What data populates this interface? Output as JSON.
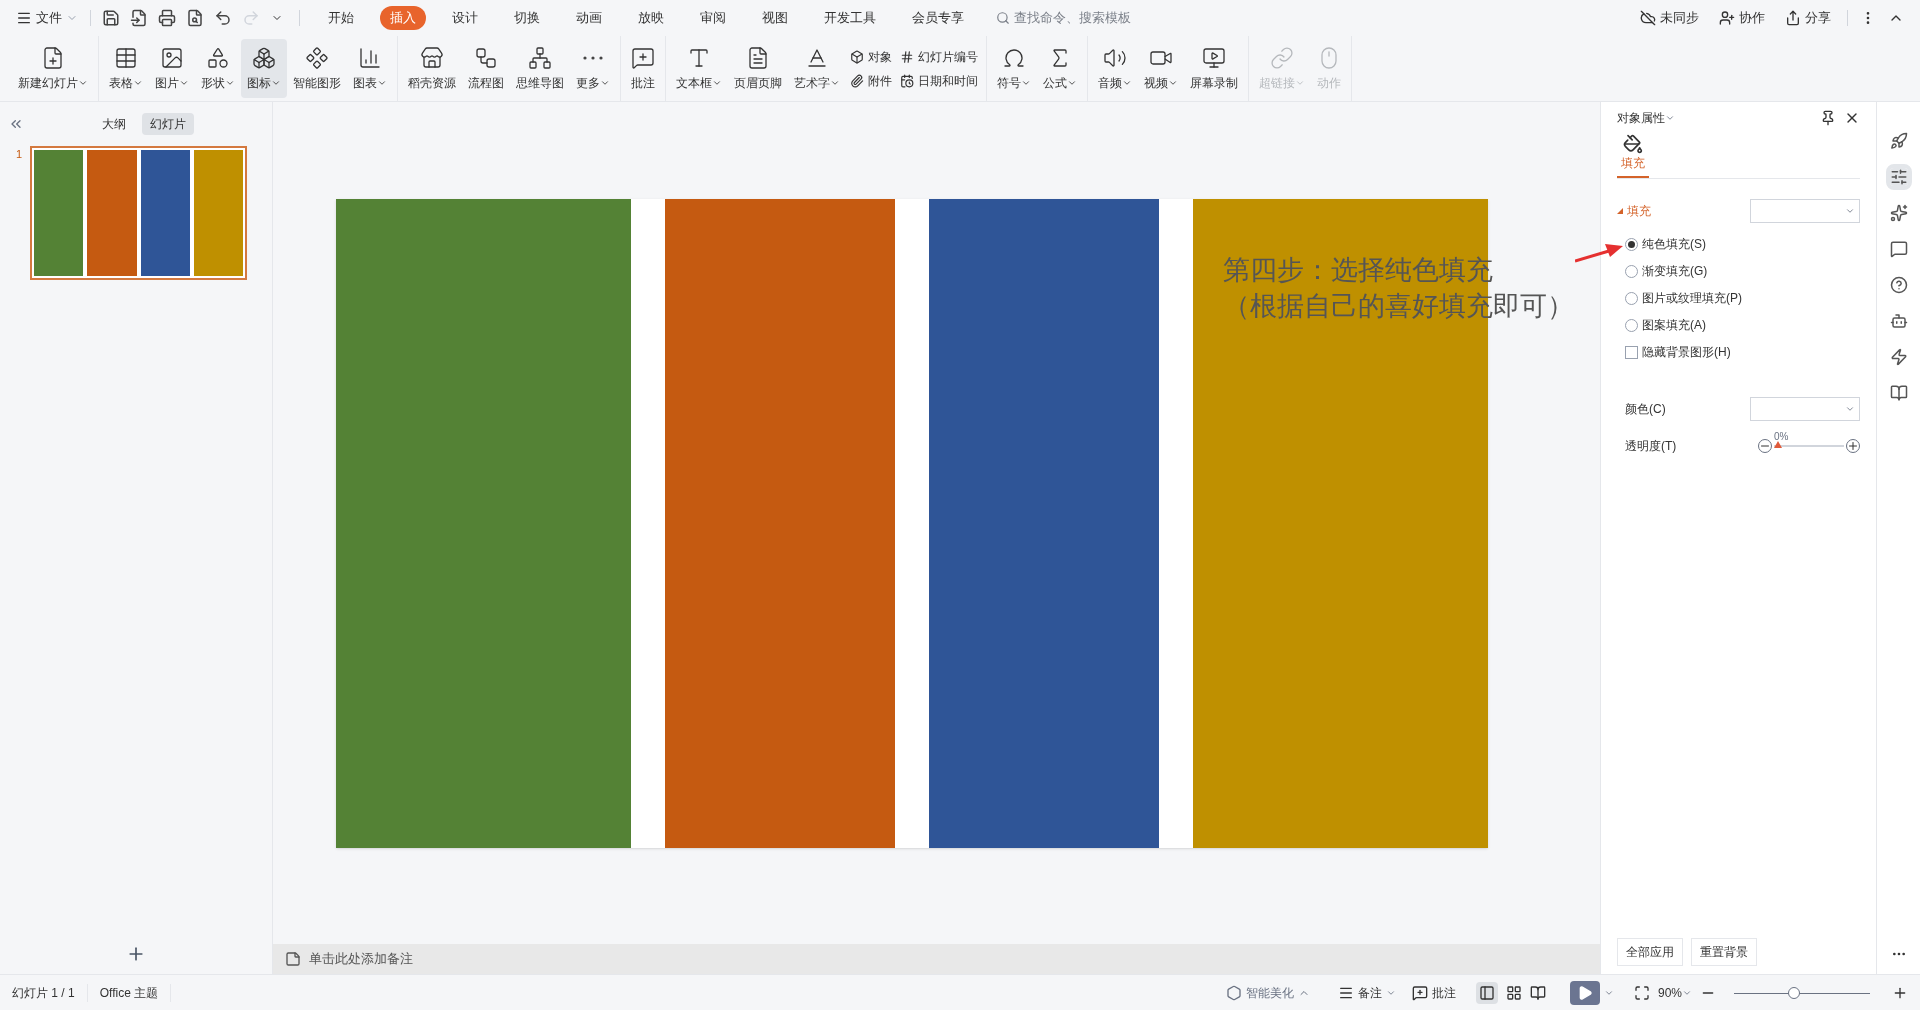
{
  "menu": {
    "file": "文件",
    "tabs": [
      {
        "label": "开始",
        "selected": false
      },
      {
        "label": "插入",
        "selected": true
      },
      {
        "label": "设计",
        "selected": false
      },
      {
        "label": "切换",
        "selected": false
      },
      {
        "label": "动画",
        "selected": false
      },
      {
        "label": "放映",
        "selected": false
      },
      {
        "label": "审阅",
        "selected": false
      },
      {
        "label": "视图",
        "selected": false
      },
      {
        "label": "开发工具",
        "selected": false
      },
      {
        "label": "会员专享",
        "selected": false
      }
    ],
    "search": {
      "placeholder": "查找命令、搜索模板"
    },
    "actions": [
      "未同步",
      "协作",
      "分享"
    ]
  },
  "ribbon": {
    "groups": [
      [
        {
          "label": "新建幻灯片",
          "dropdown": true,
          "selected": false,
          "disabled": false
        }
      ],
      [
        {
          "label": "表格",
          "dropdown": true,
          "selected": false,
          "disabled": false
        },
        {
          "label": "图片",
          "dropdown": true,
          "selected": false,
          "disabled": false
        },
        {
          "label": "形状",
          "dropdown": true,
          "selected": false,
          "disabled": false
        },
        {
          "label": "图标",
          "dropdown": true,
          "selected": true,
          "disabled": false
        },
        {
          "label": "智能图形",
          "dropdown": false,
          "selected": false,
          "disabled": false
        },
        {
          "label": "图表",
          "dropdown": true,
          "selected": false,
          "disabled": false
        }
      ],
      [
        {
          "label": "稻壳资源",
          "dropdown": false,
          "selected": false,
          "disabled": false
        },
        {
          "label": "流程图",
          "dropdown": false,
          "selected": false,
          "disabled": false
        },
        {
          "label": "思维导图",
          "dropdown": false,
          "selected": false,
          "disabled": false
        },
        {
          "label": "更多",
          "dropdown": true,
          "selected": false,
          "disabled": false
        }
      ],
      [
        {
          "label": "批注",
          "dropdown": false,
          "selected": false,
          "disabled": false
        }
      ],
      [
        {
          "label": "文本框",
          "dropdown": true,
          "selected": false,
          "disabled": false
        },
        {
          "label": "页眉页脚",
          "dropdown": false,
          "selected": false,
          "disabled": false
        },
        {
          "label": "艺术字",
          "dropdown": true,
          "selected": false,
          "disabled": false
        }
      ],
      [
        {
          "label": "符号",
          "dropdown": true,
          "selected": false,
          "disabled": false
        },
        {
          "label": "公式",
          "dropdown": true,
          "selected": false,
          "disabled": false
        }
      ],
      [
        {
          "label": "音频",
          "dropdown": true,
          "selected": false,
          "disabled": false
        },
        {
          "label": "视频",
          "dropdown": true,
          "selected": false,
          "disabled": false
        },
        {
          "label": "屏幕录制",
          "dropdown": false,
          "selected": false,
          "disabled": false
        }
      ],
      [
        {
          "label": "超链接",
          "dropdown": true,
          "selected": false,
          "disabled": true
        },
        {
          "label": "动作",
          "dropdown": false,
          "selected": false,
          "disabled": true
        }
      ]
    ],
    "small": [
      "对象",
      "附件",
      "幻灯片编号",
      "日期和时间"
    ]
  },
  "left_panel": {
    "tabs": [
      {
        "label": "大纲",
        "selected": false
      },
      {
        "label": "幻灯片",
        "selected": true
      }
    ],
    "thumbnail_number": "1"
  },
  "slide": {
    "bars": [
      {
        "color": "#548235"
      },
      {
        "color": "#c55a11"
      },
      {
        "color": "#2f5597"
      },
      {
        "color": "#bf9000"
      }
    ],
    "annotation": [
      "第四步：选择纯色填充",
      "（根据自己的喜好填充即可）"
    ]
  },
  "notes": {
    "placeholder": "单击此处添加备注"
  },
  "properties": {
    "title": "对象属性",
    "tab": {
      "label": "填充",
      "selected": true
    },
    "section": "填充",
    "options": [
      {
        "kind": "radio",
        "label": "纯色填充(S)",
        "selected": true
      },
      {
        "kind": "radio",
        "label": "渐变填充(G)",
        "selected": false
      },
      {
        "kind": "radio",
        "label": "图片或纹理填充(P)",
        "selected": false
      },
      {
        "kind": "radio",
        "label": "图案填充(A)",
        "selected": false
      },
      {
        "kind": "checkbox",
        "label": "隐藏背景图形(H)",
        "checked": false
      }
    ],
    "color_label": "颜色(C)",
    "transparency": {
      "label": "透明度(T)",
      "reading": "0%",
      "level": 0
    },
    "buttons": [
      "全部应用",
      "重置背景"
    ]
  },
  "status_bar": {
    "slide_count": "幻灯片 1 / 1",
    "theme": "Office 主题",
    "beautify": "智能美化",
    "notes": "备注",
    "comment": "批注",
    "zoom": "90%",
    "zoom_slider": {
      "level": 0.44
    }
  }
}
